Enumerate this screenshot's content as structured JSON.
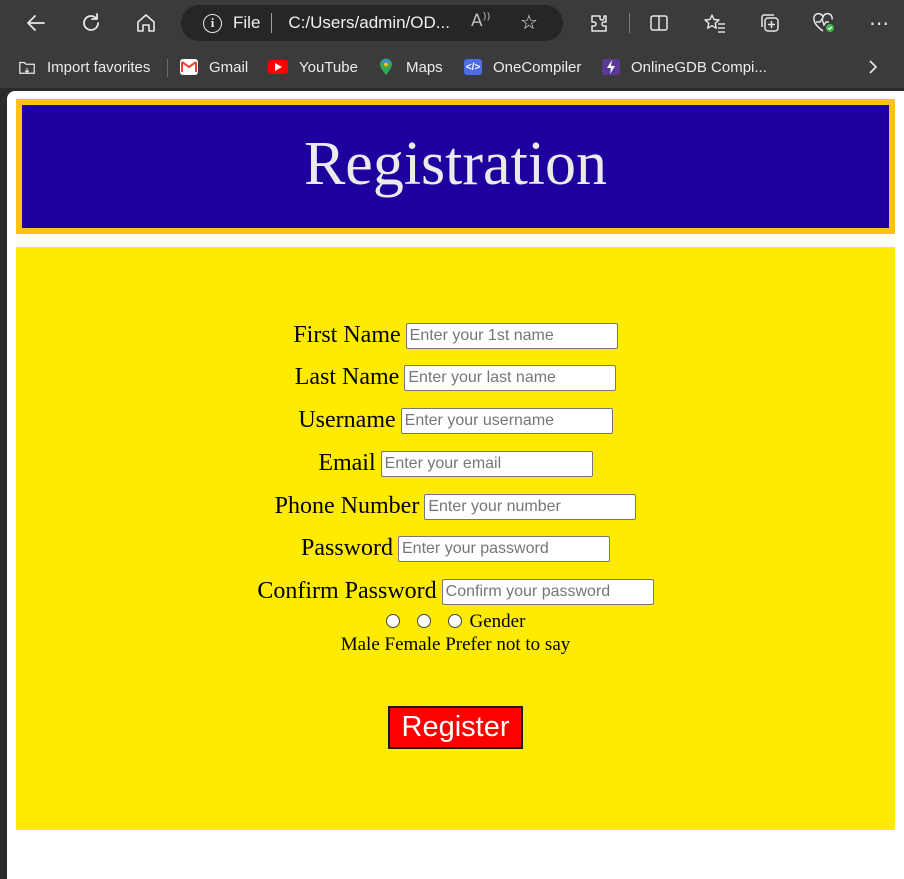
{
  "browser": {
    "address_scheme": "File",
    "address_url": "C:/Users/admin/OD...",
    "icons": [
      "back-icon",
      "refresh-icon",
      "home-icon",
      "info-icon",
      "read-aloud-icon",
      "favorite-star-icon",
      "extensions-icon",
      "split-screen-icon",
      "favorites-icon",
      "collections-icon",
      "browser-essentials-icon",
      "more-icon"
    ],
    "favorites": [
      {
        "label": "Import favorites",
        "icon": "import-folder-icon"
      },
      {
        "label": "Gmail",
        "icon": "gmail-icon",
        "color": "#ea4335"
      },
      {
        "label": "YouTube",
        "icon": "youtube-icon",
        "color": "#ff0000"
      },
      {
        "label": "Maps",
        "icon": "maps-icon",
        "color": "#34a853"
      },
      {
        "label": "OneCompiler",
        "icon": "onecompiler-icon",
        "color": "#4f6bed"
      },
      {
        "label": "OnlineGDB Compi...",
        "icon": "onlinegdb-icon",
        "color": "#6b3fa0"
      }
    ]
  },
  "page": {
    "title": "Registration",
    "colors": {
      "banner_bg": "#1e009e",
      "banner_border": "#ffc20e",
      "form_bg": "#ffeb00",
      "button_bg": "#ff0000"
    },
    "fields": [
      {
        "label": "First Name",
        "placeholder": "Enter your 1st name"
      },
      {
        "label": "Last Name",
        "placeholder": "Enter your last name"
      },
      {
        "label": "Username",
        "placeholder": "Enter your username"
      },
      {
        "label": "Email",
        "placeholder": "Enter your email"
      },
      {
        "label": "Phone Number",
        "placeholder": "Enter your number"
      },
      {
        "label": "Password",
        "placeholder": "Enter your password"
      },
      {
        "label": "Confirm Password",
        "placeholder": "Confirm your password"
      }
    ],
    "gender_label": "Gender",
    "gender_options_text": "Male Female Prefer not to say",
    "register_label": "Register"
  }
}
